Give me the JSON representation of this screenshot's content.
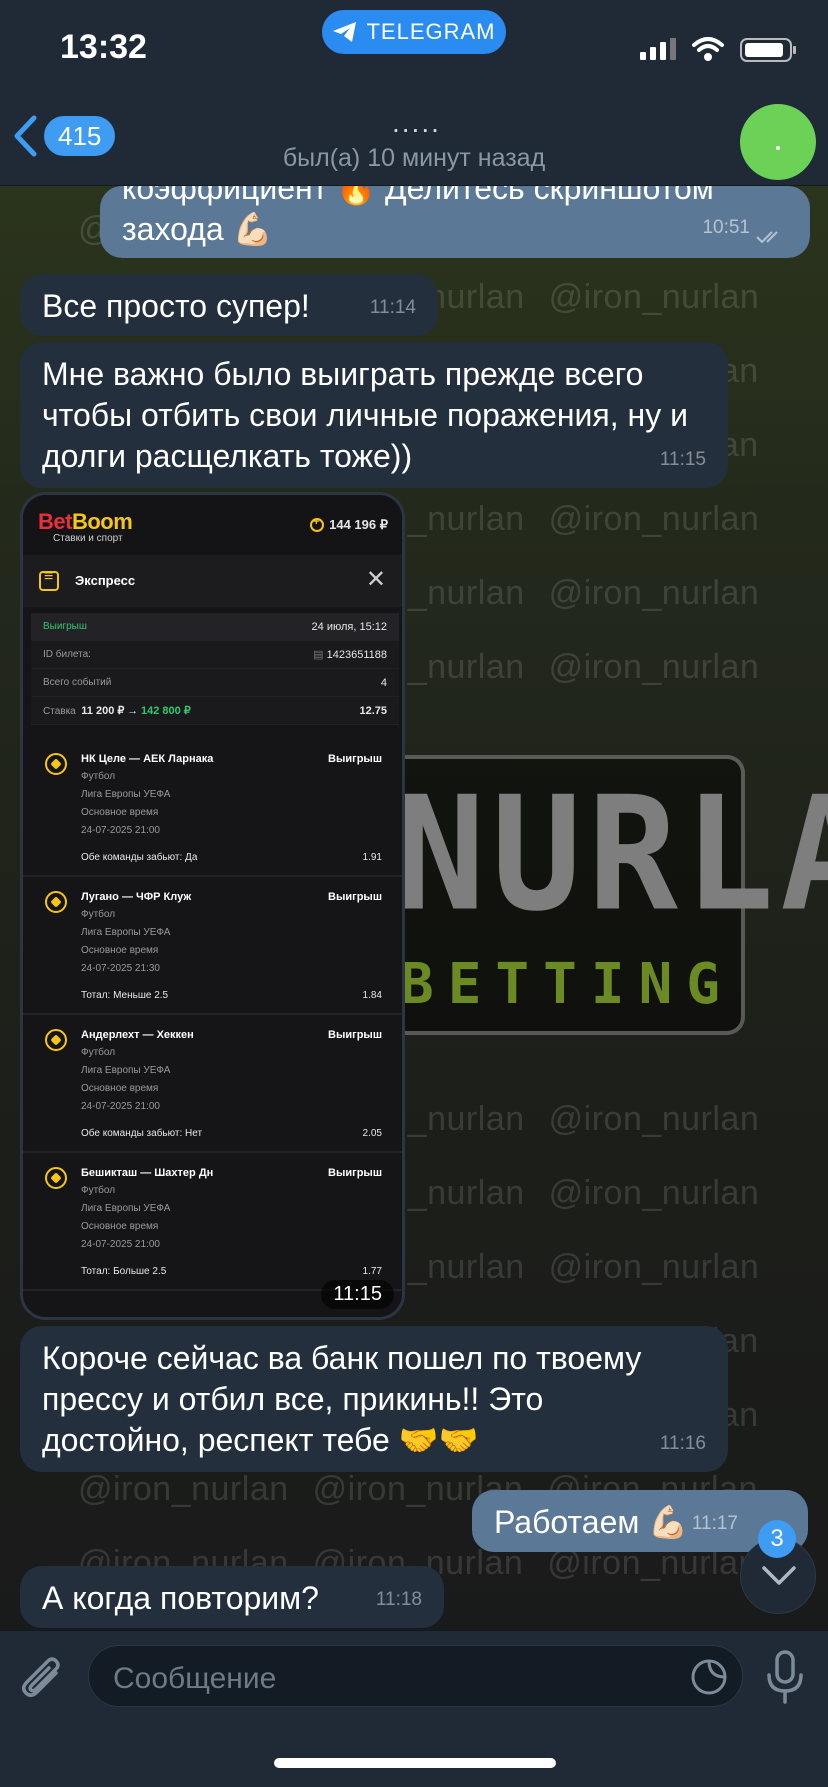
{
  "status_bar": {
    "time": "13:32",
    "app_pill": "TELEGRAM"
  },
  "header": {
    "back_count": "415",
    "typing": ".....",
    "last_seen": "был(а) 10 минут назад"
  },
  "watermark": "@iron_nurlan",
  "logo": {
    "main": "NURLAN",
    "sub": "BETTING"
  },
  "messages": [
    {
      "dir": "out",
      "text": "коэффициент 🔥 Делитесь скриншотом\nзахода 💪🏻",
      "time": "10:51"
    },
    {
      "dir": "in",
      "text": "Все просто супер!",
      "time": "11:14"
    },
    {
      "dir": "in",
      "text": "Мне важно было выиграть прежде всего\nчтобы отбить свои личные поражения, ну и\nдолги расщелкать тоже))",
      "time": "11:15"
    },
    {
      "dir": "in",
      "text": "Короче сейчас ва банк пошел по твоему\nпрессу и отбил все, прикинь!! Это\nдостойно, респект тебе 🤝🤝",
      "time": "11:16"
    },
    {
      "dir": "out",
      "text": "Работаем 💪🏻",
      "time": "11:17"
    },
    {
      "dir": "in",
      "text": "А когда повторим?",
      "time": "11:18"
    }
  ],
  "bet_card": {
    "brand_a": "Bet",
    "brand_b": "Boom",
    "brand_sub": "Ставки и спорт",
    "balance": "144 196 ₽",
    "title": "Экспресс",
    "result_label": "Выигрыш",
    "date": "24 июля, 15:12",
    "ticket_label": "ID билета:",
    "ticket_id": "1423651188",
    "events_label": "Всего событий",
    "events_count": "4",
    "stake_label": "Ставка",
    "stake": "11 200 ₽",
    "arrow": "→",
    "payout": "142 800 ₽",
    "total_odds": "12.75",
    "time": "11:15",
    "events": [
      {
        "match": "НК Целе — АЕК Ларнака",
        "status": "Выигрыш",
        "sport": "Футбол",
        "league": "Лига Европы УЕФА",
        "period": "Основное время",
        "datetime": "24-07-2025 21:00",
        "bet": "Обе команды забьют: Да",
        "odds": "1.91"
      },
      {
        "match": "Лугано — ЧФР Клуж",
        "status": "Выигрыш",
        "sport": "Футбол",
        "league": "Лига Европы УЕФА",
        "period": "Основное время",
        "datetime": "24-07-2025 21:30",
        "bet": "Тотал: Меньше 2.5",
        "odds": "1.84"
      },
      {
        "match": "Андерлехт — Хеккен",
        "status": "Выигрыш",
        "sport": "Футбол",
        "league": "Лига Европы УЕФА",
        "period": "Основное время",
        "datetime": "24-07-2025 21:00",
        "bet": "Обе команды забьют: Нет",
        "odds": "2.05"
      },
      {
        "match": "Бешикташ — Шахтер Дн",
        "status": "Выигрыш",
        "sport": "Футбол",
        "league": "Лига Европы УЕФА",
        "period": "Основное время",
        "datetime": "24-07-2025 21:00",
        "bet": "Тотал: Больше 2.5",
        "odds": "1.77"
      }
    ]
  },
  "scroll": {
    "unread": "3"
  },
  "composer": {
    "placeholder": "Сообщение"
  },
  "colors": {
    "accent": "#3e9cf3",
    "in_bubble": "#232f3d",
    "out_bubble": "#5b7896",
    "win_green": "#31c76e",
    "brand_yellow": "#f5c518"
  }
}
